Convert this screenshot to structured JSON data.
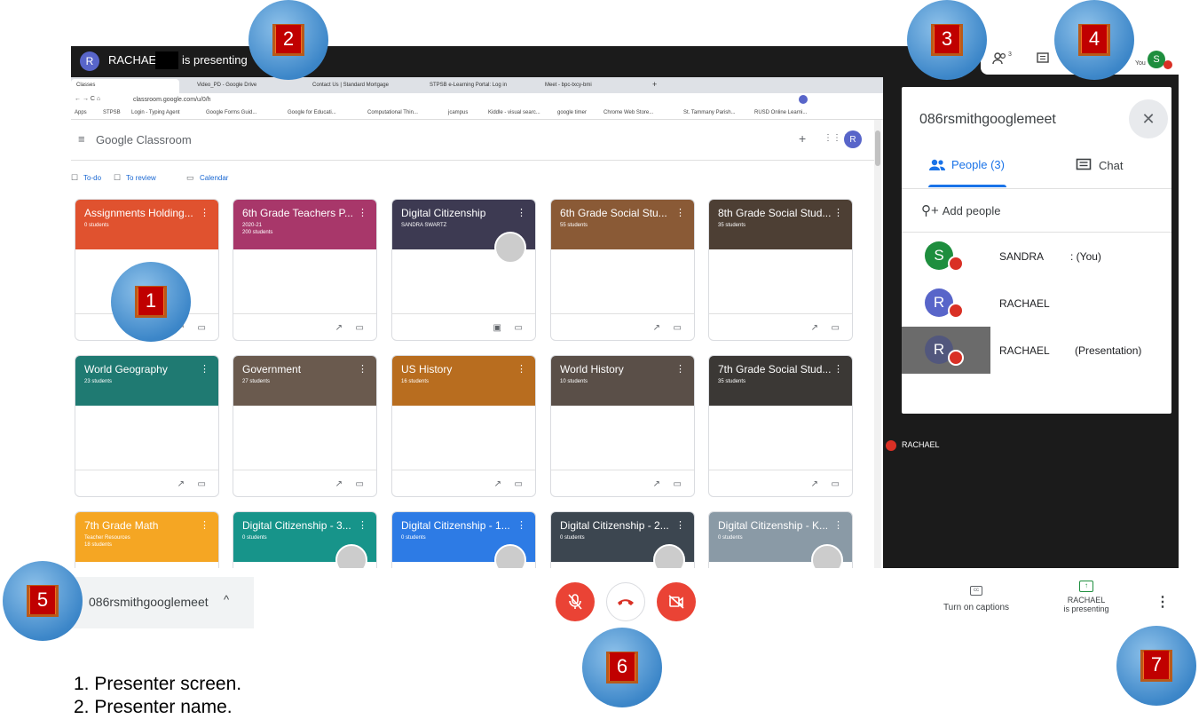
{
  "presenting_bar": {
    "avatar_letter": "R",
    "presenter_name": "RACHAEL",
    "suffix": "is presenting"
  },
  "top_right": {
    "people_count": "3",
    "you_label": "You",
    "you_initial": "S"
  },
  "browser": {
    "tabs": [
      "Classes",
      "Video_PD - Google Drive",
      "Contact Us | Standard Mortgage",
      "STPSB e-Learning Portal: Log in",
      "Meet - bpc-txcy-bmi"
    ],
    "url": "classroom.google.com/u/0/h",
    "bookmarks": [
      "Apps",
      "STPSB",
      "Login - Typing Agent",
      "Google Forms Guid...",
      "Google for Educati...",
      "Computational Thin...",
      "jcampus",
      "Kiddle - visual searc...",
      "google timer",
      "Chrome Web Store...",
      "St. Tammany Parish...",
      "RUSD Online Learni..."
    ]
  },
  "classroom": {
    "brand": "Google Classroom",
    "nav": {
      "todo": "To-do",
      "review": "To review",
      "calendar": "Calendar"
    },
    "avatar_letter": "R",
    "cards": [
      {
        "title": "Assignments Holding...",
        "sub": "",
        "count": "0 students",
        "color": "#e0522f"
      },
      {
        "title": "6th Grade Teachers P...",
        "sub": "2020-21",
        "count": "200 students",
        "color": "#a8376a"
      },
      {
        "title": "Digital Citizenship",
        "sub": "SANDRA SWARTZ",
        "count": "",
        "color": "#3d3a52"
      },
      {
        "title": "6th Grade Social Stu...",
        "sub": "",
        "count": "55 students",
        "color": "#8a5a36"
      },
      {
        "title": "8th Grade Social Stud...",
        "sub": "",
        "count": "35 students",
        "color": "#4d3f34"
      },
      {
        "title": "World Geography",
        "sub": "",
        "count": "23 students",
        "color": "#1f7a72"
      },
      {
        "title": "Government",
        "sub": "",
        "count": "27 students",
        "color": "#6a5a4e"
      },
      {
        "title": "US History",
        "sub": "",
        "count": "16 students",
        "color": "#b86d1f"
      },
      {
        "title": "World History",
        "sub": "",
        "count": "10 students",
        "color": "#5a4f48"
      },
      {
        "title": "7th Grade Social Stud...",
        "sub": "",
        "count": "35 students",
        "color": "#3b3835"
      },
      {
        "title": "7th Grade Math",
        "sub": "Teacher Resources",
        "count": "18 students",
        "color": "#f5a623"
      },
      {
        "title": "Digital Citizenship - 3...",
        "sub": "",
        "count": "0 students",
        "color": "#17948a"
      },
      {
        "title": "Digital Citizenship - 1...",
        "sub": "",
        "count": "0 students",
        "color": "#2d7be5"
      },
      {
        "title": "Digital Citizenship - 2...",
        "sub": "",
        "count": "0 students",
        "color": "#3c4650"
      },
      {
        "title": "Digital Citizenship - K...",
        "sub": "",
        "count": "0 students",
        "color": "#8a9aa6"
      }
    ]
  },
  "tile": {
    "name": "RACHAEL"
  },
  "panel": {
    "title": "086rsmithgooglemeet",
    "tab_people": "People (3)",
    "tab_chat": "Chat",
    "add_people": "Add people",
    "participants": [
      {
        "initial": "S",
        "name": "SANDRA",
        "note": ": (You)",
        "color": "#1e8e3e"
      },
      {
        "initial": "R",
        "name": "RACHAEL",
        "note": "",
        "color": "#5865c9"
      },
      {
        "initial": "R",
        "name": "RACHAEL",
        "note": "(Presentation)",
        "color": "#5865c9"
      }
    ]
  },
  "bottom": {
    "meeting_code": "086rsmithgooglemeet",
    "captions": "Turn on captions",
    "presenter_line1": "RACHAEL",
    "presenter_line2": "is presenting"
  },
  "markers": [
    "1",
    "2",
    "3",
    "4",
    "5",
    "6",
    "7"
  ],
  "notes": [
    "1.   Presenter screen.",
    "2.   Presenter name."
  ]
}
